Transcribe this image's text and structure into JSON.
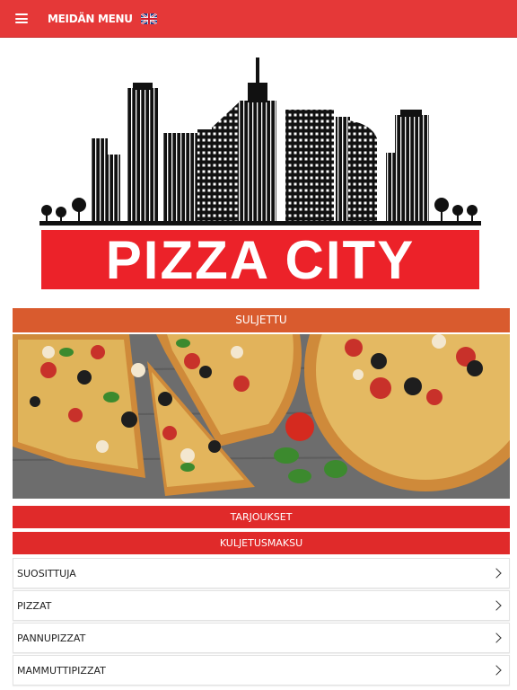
{
  "header": {
    "title": "MEIDÄN MENU",
    "menu_icon": "hamburger-icon",
    "language_flag": "uk-flag-icon",
    "bg_color": "#e53838"
  },
  "logo": {
    "text": "PIZZA CITY",
    "banner_color": "#ec2229"
  },
  "status": {
    "label": "SULJETTU",
    "color": "#d95b2e"
  },
  "buttons": {
    "offers": "TARJOUKSET",
    "delivery_fee": "KULJETUSMAKSU",
    "color": "#e02a2a"
  },
  "categories": [
    {
      "label": "SUOSITTUJA"
    },
    {
      "label": "PIZZAT"
    },
    {
      "label": "PANNUPIZZAT"
    },
    {
      "label": "MAMMUTTIPIZZAT"
    }
  ]
}
